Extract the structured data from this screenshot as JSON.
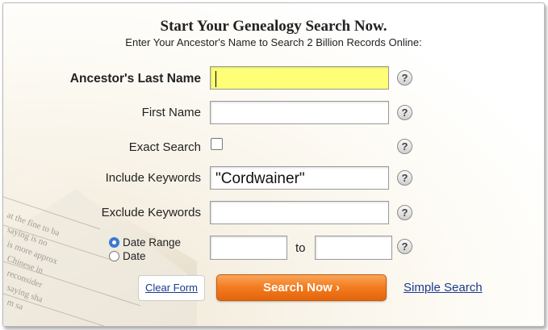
{
  "header": {
    "title": "Start Your Genealogy Search Now.",
    "subtitle": "Enter Your Ancestor's Name to Search 2 Billion Records Online:"
  },
  "fields": {
    "last_name_label": "Ancestor's Last Name",
    "last_name_value": "",
    "first_name_label": "First Name",
    "first_name_value": "",
    "exact_label": "Exact Search",
    "exact_checked": false,
    "include_label": "Include Keywords",
    "include_value": "\"Cordwainer\"",
    "exclude_label": "Exclude Keywords",
    "exclude_value": "",
    "date_range_label": "Date Range",
    "date_label": "Date",
    "date_range_selected": true,
    "to_label": "to"
  },
  "help": {
    "glyph": "?"
  },
  "buttons": {
    "clear": "Clear Form",
    "search": "Search Now ›",
    "simple": "Simple Search"
  },
  "colors": {
    "highlight_input": "#ffff77",
    "search_button": "#f47e22",
    "link": "#1a3a8f"
  },
  "newspaper_text": [
    "at the fine to ba",
    "saying is no",
    "is more approx",
    "Chinese in",
    "reconsider",
    "saying sha",
    "m sa"
  ]
}
